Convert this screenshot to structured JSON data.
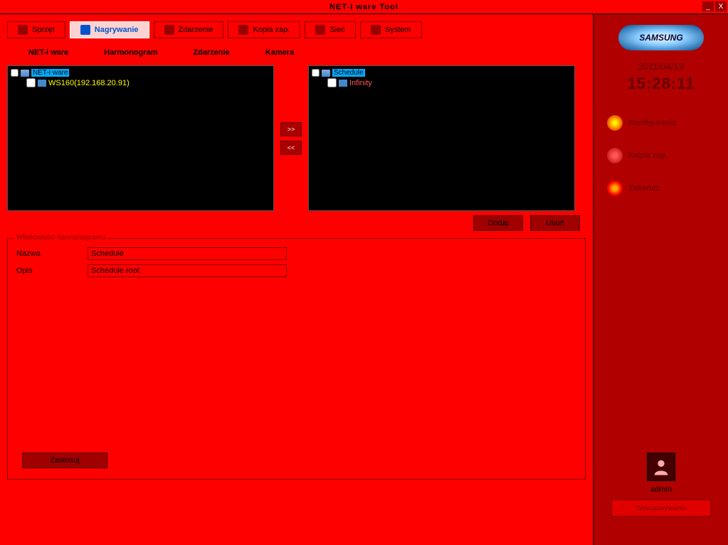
{
  "window": {
    "title": "NET-i ware Tool"
  },
  "tabs": {
    "hardware": "Sprzęt",
    "recording": "Nagrywanie",
    "event": "Zdarzenie",
    "backup": "Kopia zap.",
    "network": "Sieć",
    "system": "System"
  },
  "subtabs": {
    "netware": "NET-i ware",
    "schedule": "Harmonogram",
    "event": "Zdarzenie",
    "camera": "Kamera"
  },
  "left_tree": {
    "root": "NET-i ware",
    "child": "WS160(192.168.20.91)"
  },
  "right_tree": {
    "root": "Schedule",
    "child": "Infinity"
  },
  "middle": {
    "right": ">>",
    "left": "<<"
  },
  "actions": {
    "add": "Dodaj",
    "delete": "Usuń"
  },
  "fieldset": {
    "legend": "Właściwości harmonogramu",
    "name_label": "Nazwa",
    "name_value": "Schedule",
    "desc_label": "Opis",
    "desc_value": "Schedule root",
    "apply": "Zastosuj"
  },
  "sidebar": {
    "logo": "SAMSUNG",
    "date": "2011/04/13",
    "time": "15:28:11",
    "config": "Konfiguracja",
    "backup": "Kopia zap.",
    "exit": "Zakończ",
    "user": "admin",
    "logout": "Wylogowywanie"
  }
}
